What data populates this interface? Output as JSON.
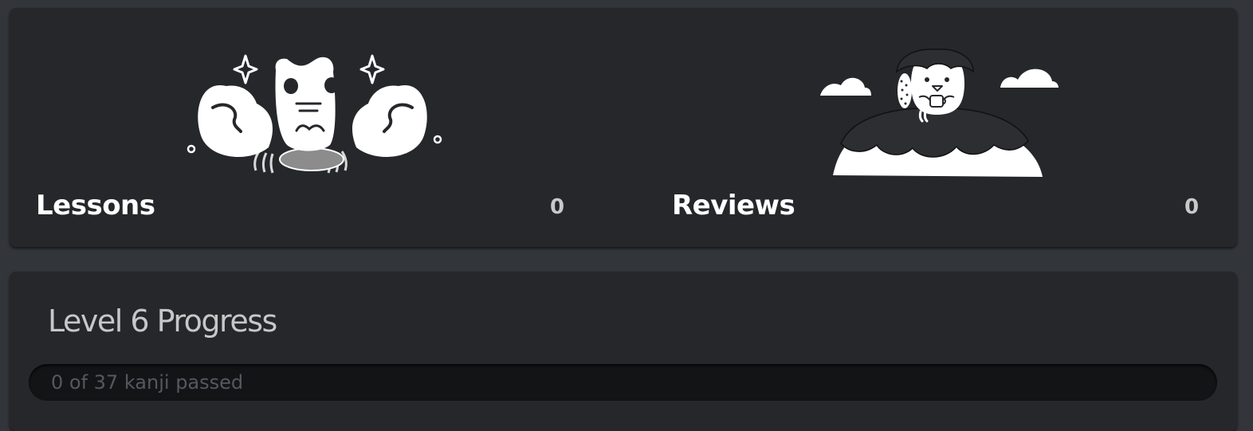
{
  "lessons": {
    "label": "Lessons",
    "count": "0",
    "icon": "crab-mascot-icon"
  },
  "reviews": {
    "label": "Reviews",
    "count": "0",
    "icon": "mountain-mascot-icon"
  },
  "progress": {
    "title": "Level 6 Progress",
    "status_text": "0 of 37 kanji passed",
    "passed": 0,
    "total": 37
  },
  "colors": {
    "background": "#32353a",
    "panel": "#25272b",
    "track": "#131416",
    "title_text": "#ffffff",
    "count_text": "#c9c9c9"
  }
}
